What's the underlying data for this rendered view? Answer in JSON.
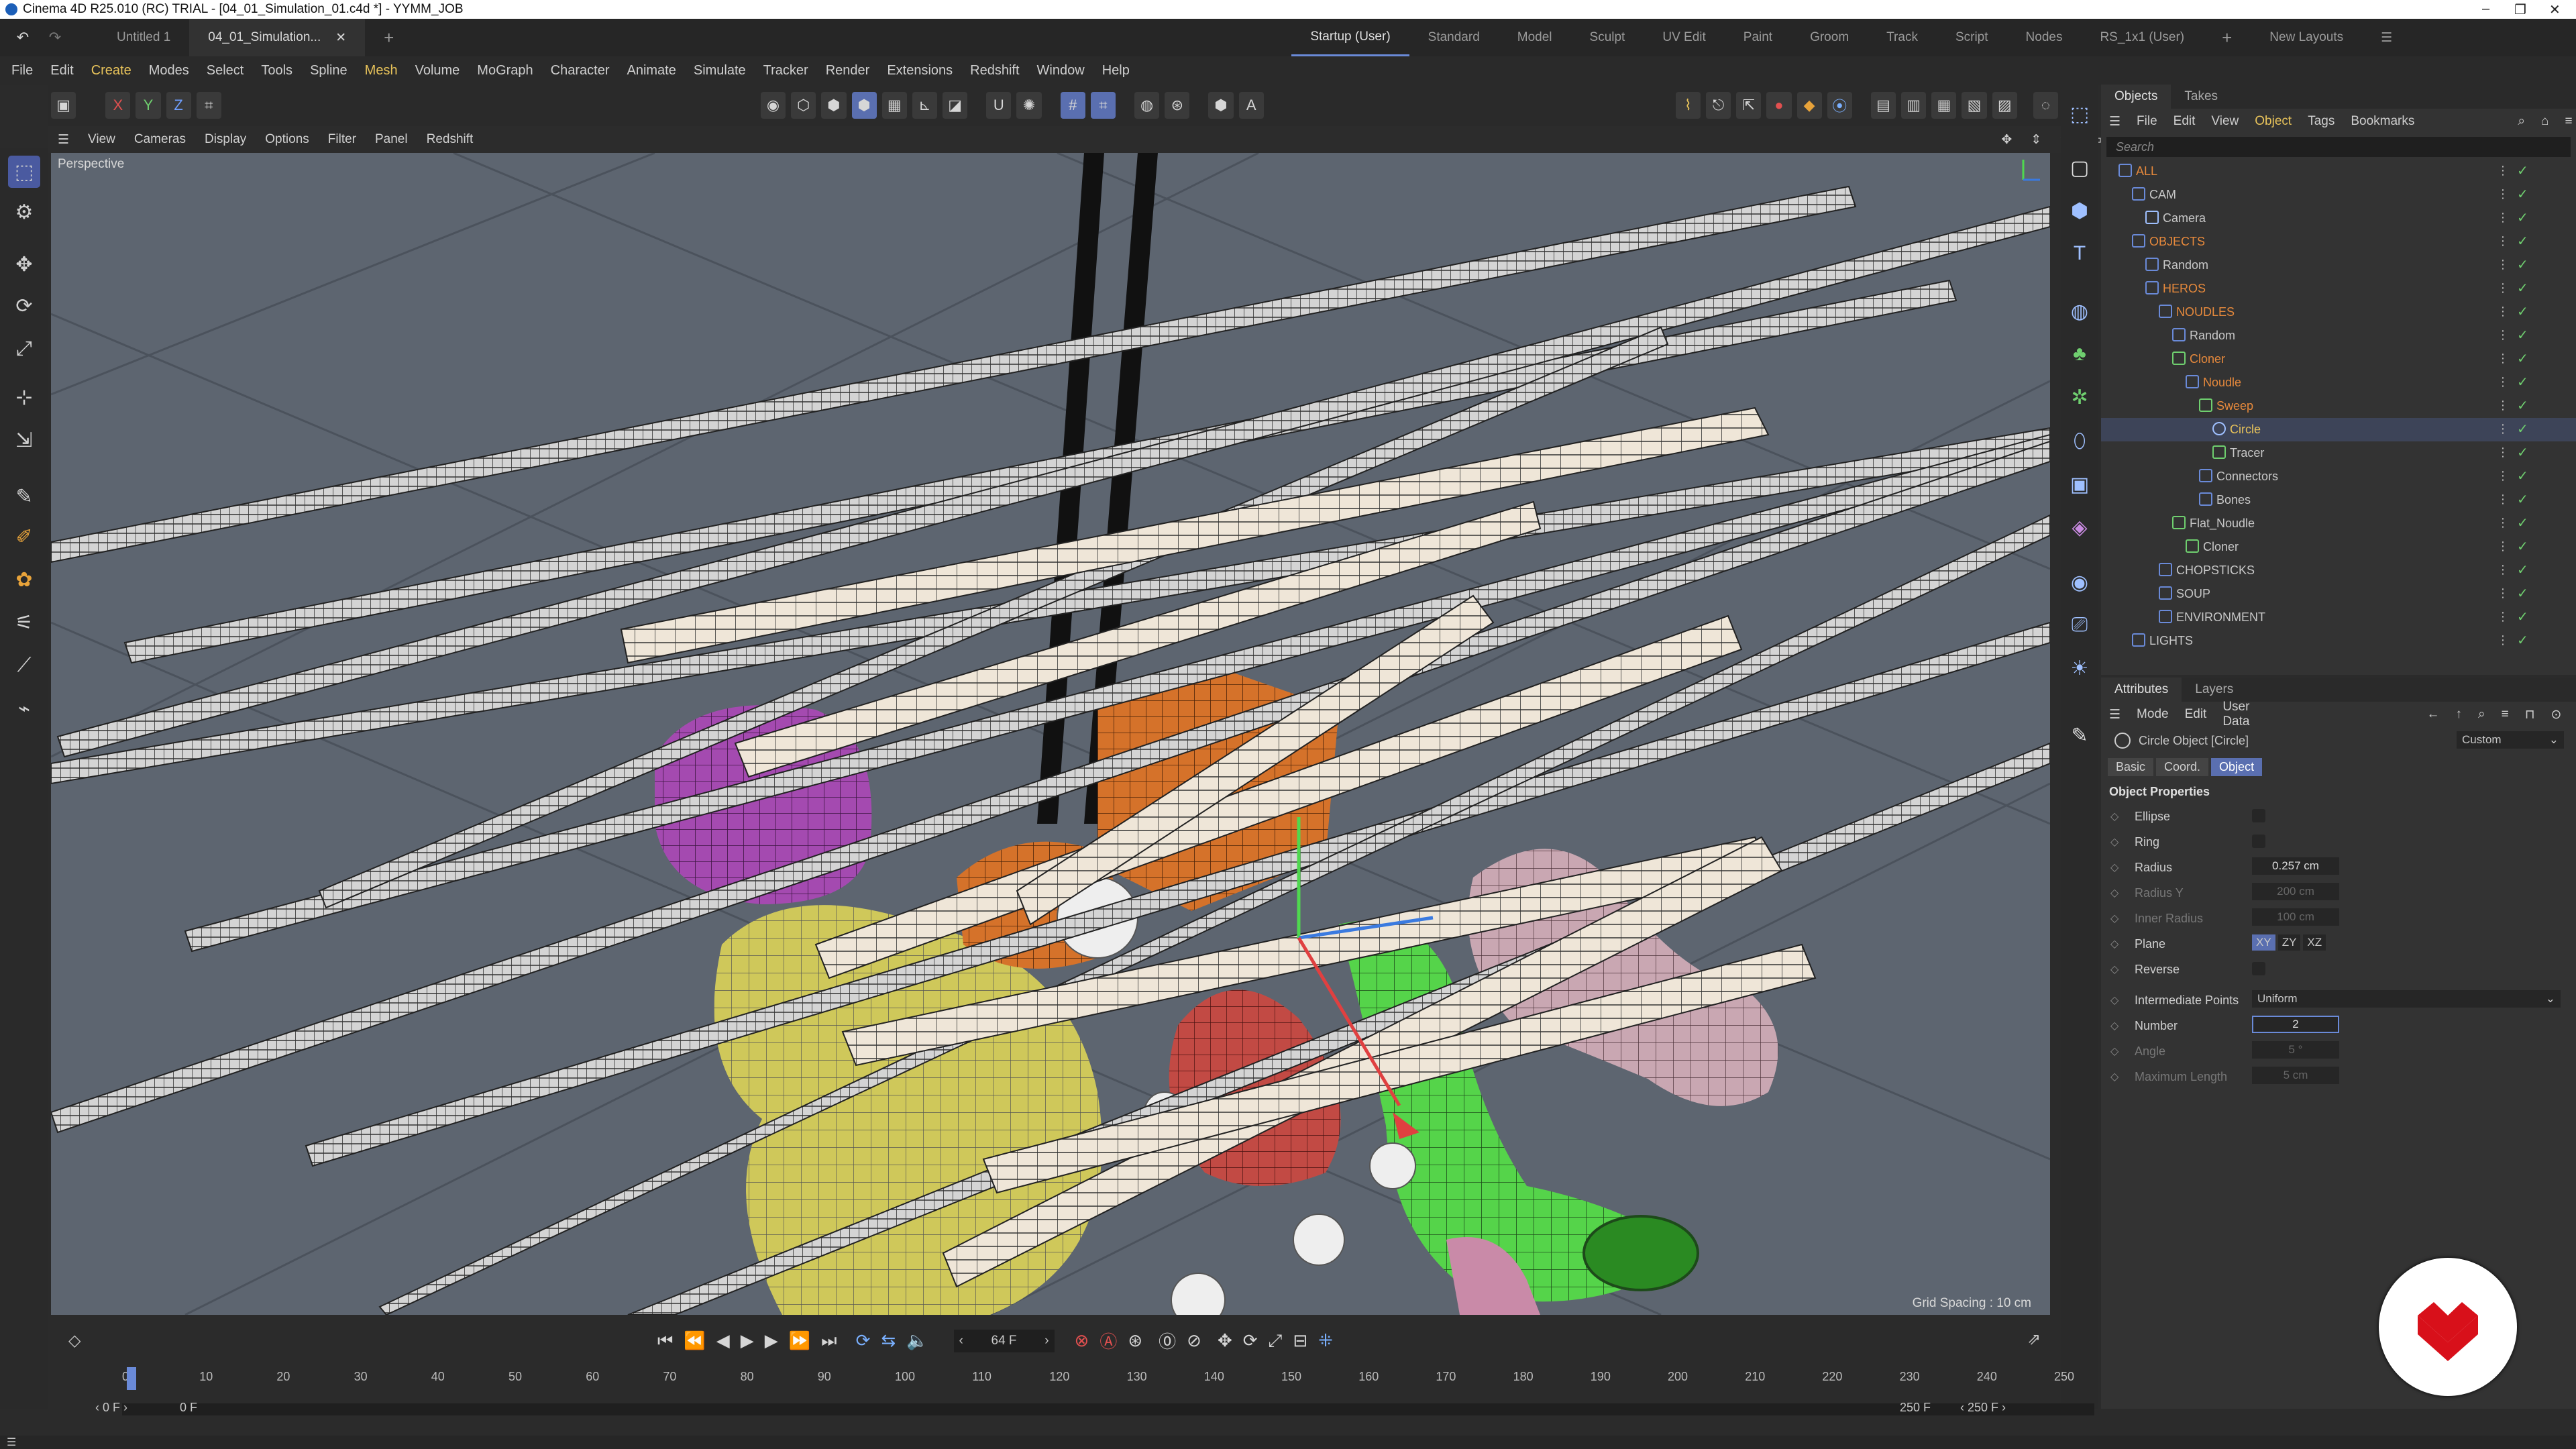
{
  "window": {
    "title": "Cinema 4D R25.010 (RC) TRIAL - [04_01_Simulation_01.c4d *] - YYMM_JOB"
  },
  "doc_tabs": [
    {
      "label": "Untitled 1",
      "active": false
    },
    {
      "label": "04_01_Simulation...",
      "active": true
    }
  ],
  "layout_tabs": [
    "Startup (User)",
    "Standard",
    "Model",
    "Sculpt",
    "UV Edit",
    "Paint",
    "Groom",
    "Track",
    "Script",
    "Nodes",
    "RS_1x1 (User)"
  ],
  "layout_active": "Startup (User)",
  "new_layouts": "New Layouts",
  "menu": [
    "File",
    "Edit",
    "Create",
    "Modes",
    "Select",
    "Tools",
    "Spline",
    "Mesh",
    "Volume",
    "MoGraph",
    "Character",
    "Animate",
    "Simulate",
    "Tracker",
    "Render",
    "Extensions",
    "Redshift",
    "Window",
    "Help"
  ],
  "menu_highlight": [
    "Create",
    "Mesh"
  ],
  "axis_lock": [
    "X",
    "Y",
    "Z"
  ],
  "viewport": {
    "menu": [
      "View",
      "Cameras",
      "Display",
      "Options",
      "Filter",
      "Panel",
      "Redshift"
    ],
    "name": "Perspective",
    "grid_spacing": "Grid Spacing : 10 cm"
  },
  "objects_panel": {
    "tabs": [
      "Objects",
      "Takes"
    ],
    "menu": [
      "File",
      "Edit",
      "View",
      "Object",
      "Tags",
      "Bookmarks"
    ],
    "menu_highlight": "Object",
    "search_placeholder": "Search",
    "tree": [
      {
        "name": "ALL",
        "depth": 0,
        "color": "orange",
        "type": "null"
      },
      {
        "name": "CAM",
        "depth": 1,
        "color": "white",
        "type": "null"
      },
      {
        "name": "Camera",
        "depth": 2,
        "color": "white",
        "type": "camera"
      },
      {
        "name": "OBJECTS",
        "depth": 1,
        "color": "orange",
        "type": "null"
      },
      {
        "name": "Random",
        "depth": 2,
        "color": "white",
        "type": "effector"
      },
      {
        "name": "HEROS",
        "depth": 2,
        "color": "orange",
        "type": "null"
      },
      {
        "name": "NOUDLES",
        "depth": 3,
        "color": "orange",
        "type": "null"
      },
      {
        "name": "Random",
        "depth": 4,
        "color": "white",
        "type": "effector"
      },
      {
        "name": "Cloner",
        "depth": 4,
        "color": "orange",
        "type": "cloner"
      },
      {
        "name": "Noudle",
        "depth": 5,
        "color": "orange",
        "type": "null"
      },
      {
        "name": "Sweep",
        "depth": 6,
        "color": "orange",
        "type": "sweep"
      },
      {
        "name": "Circle",
        "depth": 7,
        "color": "yellow",
        "type": "circle"
      },
      {
        "name": "Tracer",
        "depth": 7,
        "color": "white",
        "type": "tracer"
      },
      {
        "name": "Connectors",
        "depth": 6,
        "color": "white",
        "type": "null"
      },
      {
        "name": "Bones",
        "depth": 6,
        "color": "white",
        "type": "null"
      },
      {
        "name": "Flat_Noudle",
        "depth": 4,
        "color": "white",
        "type": "cloner"
      },
      {
        "name": "Cloner",
        "depth": 5,
        "color": "white",
        "type": "cloner"
      },
      {
        "name": "CHOPSTICKS",
        "depth": 3,
        "color": "white",
        "type": "null"
      },
      {
        "name": "SOUP",
        "depth": 3,
        "color": "white",
        "type": "null"
      },
      {
        "name": "ENVIRONMENT",
        "depth": 3,
        "color": "white",
        "type": "null"
      },
      {
        "name": "LIGHTS",
        "depth": 1,
        "color": "white",
        "type": "null"
      }
    ]
  },
  "attributes_panel": {
    "tabs": [
      "Attributes",
      "Layers"
    ],
    "menu": [
      "Mode",
      "Edit",
      "User Data"
    ],
    "object_title": "Circle Object [Circle]",
    "preset": "Custom",
    "subtabs": [
      "Basic",
      "Coord.",
      "Object"
    ],
    "subtab_active": "Object",
    "section": "Object Properties",
    "props": {
      "ellipse": "Ellipse",
      "ring": "Ring",
      "radius": "Radius",
      "radius_val": "0.257 cm",
      "radius_y": "Radius Y",
      "radius_y_val": "200 cm",
      "inner_radius": "Inner Radius",
      "inner_radius_val": "100 cm",
      "plane": "Plane",
      "plane_opts": [
        "XY",
        "ZY",
        "XZ"
      ],
      "plane_active": "XY",
      "reverse": "Reverse",
      "intermediate": "Intermediate Points",
      "intermediate_val": "Uniform",
      "number": "Number",
      "number_val": "2",
      "angle": "Angle",
      "angle_val": "5 °",
      "max_length": "Maximum Length",
      "max_length_val": "5 cm"
    }
  },
  "timeline": {
    "current_frame": "64 F",
    "start": "0 F",
    "start2": "0 F",
    "end": "250 F",
    "end2": "250 F",
    "ticks": [
      "0",
      "10",
      "20",
      "30",
      "40",
      "50",
      "60",
      "70",
      "80",
      "90",
      "100",
      "110",
      "120",
      "130",
      "140",
      "150",
      "160",
      "170",
      "180",
      "190",
      "200",
      "210",
      "220",
      "230",
      "240",
      "250"
    ]
  },
  "colors": {
    "accent": "#5a6fb0",
    "orange_item": "#e6893c",
    "yellow_item": "#e8c35a",
    "viewport_bg": "#5d6570",
    "badge_red": "#d8101a"
  }
}
